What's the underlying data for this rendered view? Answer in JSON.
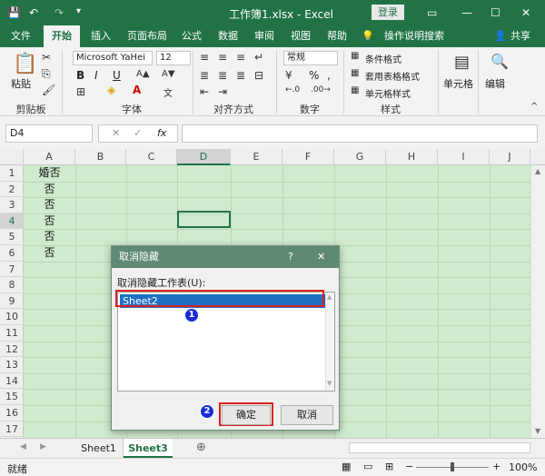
{
  "titlebar": {
    "title": "工作簿1.xlsx  -  Excel",
    "login": "登录"
  },
  "tabs": [
    "文件",
    "开始",
    "插入",
    "页面布局",
    "公式",
    "数据",
    "审阅",
    "视图",
    "帮助",
    "操作说明搜索",
    "共享"
  ],
  "ribbon": {
    "clipboard": {
      "paste": "粘贴",
      "label": "剪贴板"
    },
    "font": {
      "name": "Microsoft YaHei",
      "size": "12",
      "bold": "B",
      "italic": "I",
      "underline": "U",
      "label": "字体"
    },
    "alignment": {
      "label": "对齐方式"
    },
    "number": {
      "format": "常规",
      "percent": "%",
      "label": "数字"
    },
    "styles": {
      "cond": "条件格式",
      "table": "套用表格格式",
      "cell": "单元格样式",
      "label": "样式"
    },
    "cells": {
      "label": "单元格"
    },
    "editing": {
      "label": "编辑"
    }
  },
  "formulabar": {
    "namebox": "D4",
    "fx": "fx",
    "cancel": "✕",
    "enter": "✓",
    "value": ""
  },
  "grid": {
    "columns": [
      "A",
      "B",
      "C",
      "D",
      "E",
      "F",
      "G",
      "H",
      "I",
      "J"
    ],
    "rows": [
      "1",
      "2",
      "3",
      "4",
      "5",
      "6",
      "7",
      "8",
      "9",
      "10",
      "11",
      "12",
      "13",
      "14",
      "15",
      "16",
      "17"
    ],
    "colA": [
      "婚否",
      "否",
      "否",
      "否",
      "否",
      "否"
    ],
    "selected_cell": "D4"
  },
  "sheets": [
    "Sheet1",
    "Sheet3"
  ],
  "status": {
    "ready": "就绪",
    "zoom": "100%"
  },
  "dialog": {
    "title": "取消隐藏",
    "help": "?",
    "close": "✕",
    "label": "取消隐藏工作表(U):",
    "items": [
      "Sheet2"
    ],
    "ok": "确定",
    "cancel": "取消",
    "marker1": "1",
    "marker2": "2"
  }
}
